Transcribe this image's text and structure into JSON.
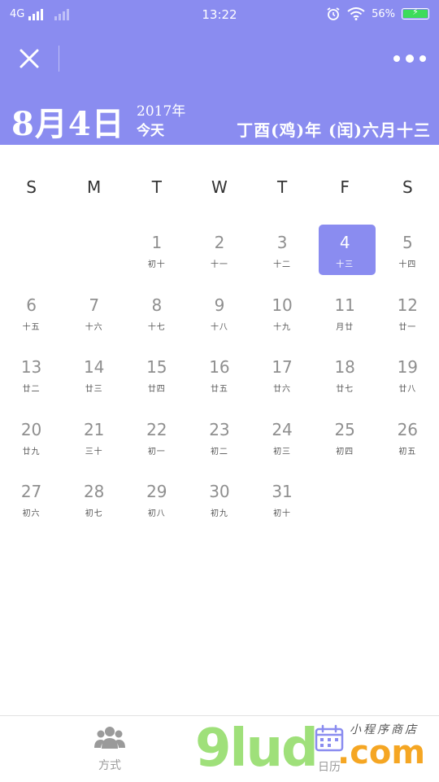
{
  "status_bar": {
    "network": "4G",
    "time": "13:22",
    "battery_percent": "56%",
    "icons": [
      "alarm-icon",
      "wifi-icon",
      "battery-icon"
    ]
  },
  "header": {
    "date": "8月4日",
    "year": "2017年",
    "today": "今天",
    "lunar": "丁酉(鸡)年 (闰)六月十三"
  },
  "weekdays": [
    "S",
    "M",
    "T",
    "W",
    "T",
    "F",
    "S"
  ],
  "calendar": {
    "leading_blanks": 2,
    "selected_day": "4",
    "days": [
      {
        "d": "1",
        "l": "初十"
      },
      {
        "d": "2",
        "l": "十一"
      },
      {
        "d": "3",
        "l": "十二"
      },
      {
        "d": "4",
        "l": "十三"
      },
      {
        "d": "5",
        "l": "十四"
      },
      {
        "d": "6",
        "l": "十五"
      },
      {
        "d": "7",
        "l": "十六"
      },
      {
        "d": "8",
        "l": "十七"
      },
      {
        "d": "9",
        "l": "十八"
      },
      {
        "d": "10",
        "l": "十九"
      },
      {
        "d": "11",
        "l": "月廿"
      },
      {
        "d": "12",
        "l": "廿一"
      },
      {
        "d": "13",
        "l": "廿二"
      },
      {
        "d": "14",
        "l": "廿三"
      },
      {
        "d": "15",
        "l": "廿四"
      },
      {
        "d": "16",
        "l": "廿五"
      },
      {
        "d": "17",
        "l": "廿六"
      },
      {
        "d": "18",
        "l": "廿七"
      },
      {
        "d": "19",
        "l": "廿八"
      },
      {
        "d": "20",
        "l": "廿九"
      },
      {
        "d": "21",
        "l": "三十"
      },
      {
        "d": "22",
        "l": "初一"
      },
      {
        "d": "23",
        "l": "初二"
      },
      {
        "d": "24",
        "l": "初三"
      },
      {
        "d": "25",
        "l": "初四"
      },
      {
        "d": "26",
        "l": "初五"
      },
      {
        "d": "27",
        "l": "初六"
      },
      {
        "d": "28",
        "l": "初七"
      },
      {
        "d": "29",
        "l": "初八"
      },
      {
        "d": "30",
        "l": "初九"
      },
      {
        "d": "31",
        "l": "初十"
      }
    ]
  },
  "tabbar": {
    "tab1_label": "方式",
    "tab2_label": "日历"
  },
  "watermark": {
    "brand": "9lud",
    "suffix": ".com",
    "small": "小程序商店"
  },
  "colors": {
    "accent": "#8a8cf0",
    "day_number": "#8f8f8f",
    "lunar_text": "#555555"
  }
}
